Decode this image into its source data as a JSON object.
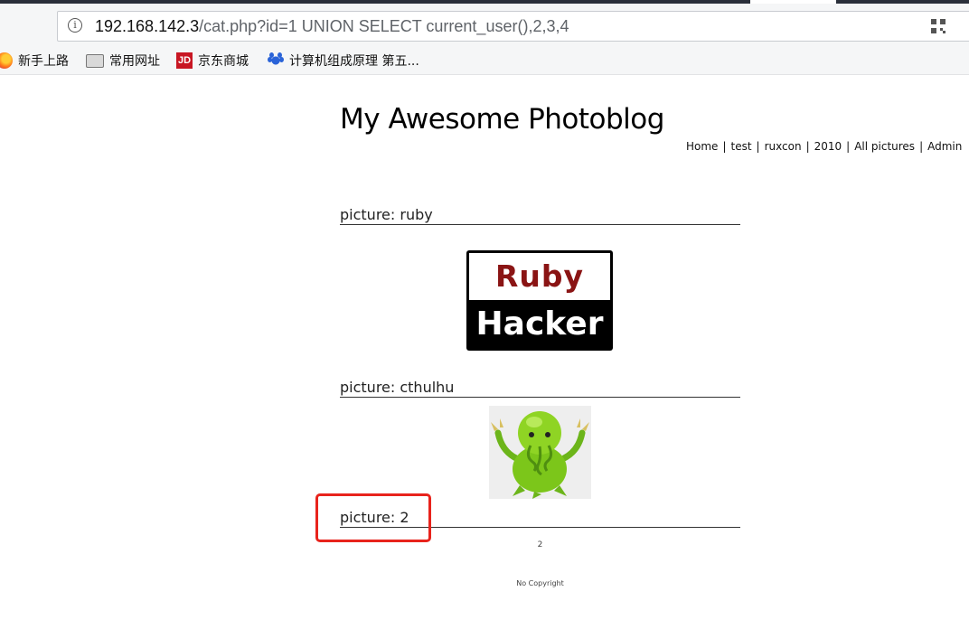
{
  "browser": {
    "url_host": "192.168.142.3",
    "url_path": "/cat.php?id=1 UNION SELECT current_user(),2,3,4",
    "bookmarks": [
      {
        "label": "新手上路",
        "icon": "firefox-icon"
      },
      {
        "label": "常用网址",
        "icon": "folder-icon"
      },
      {
        "label": "京东商城",
        "icon": "jd-icon",
        "icon_text": "JD"
      },
      {
        "label": "计算机组成原理 第五...",
        "icon": "baidu-paw-icon"
      }
    ]
  },
  "site": {
    "title": "My Awesome Photoblog",
    "nav": [
      "Home",
      "test",
      "ruxcon",
      "2010",
      "All pictures",
      "Admin"
    ],
    "nav_separator": "|"
  },
  "pictures": [
    {
      "label": "picture: ruby",
      "image": "ruby-hacker-image",
      "image_text_top": "Ruby",
      "image_text_bottom": "Hacker"
    },
    {
      "label": "picture: cthulhu",
      "image": "cthulhu-image"
    },
    {
      "label": "picture: 2",
      "value": "2"
    }
  ],
  "footer": {
    "text": "No Copyright"
  },
  "colors": {
    "highlight": "#e8231c",
    "ruby_text": "#8a1414",
    "cthulhu_green": "#7cc61a"
  }
}
